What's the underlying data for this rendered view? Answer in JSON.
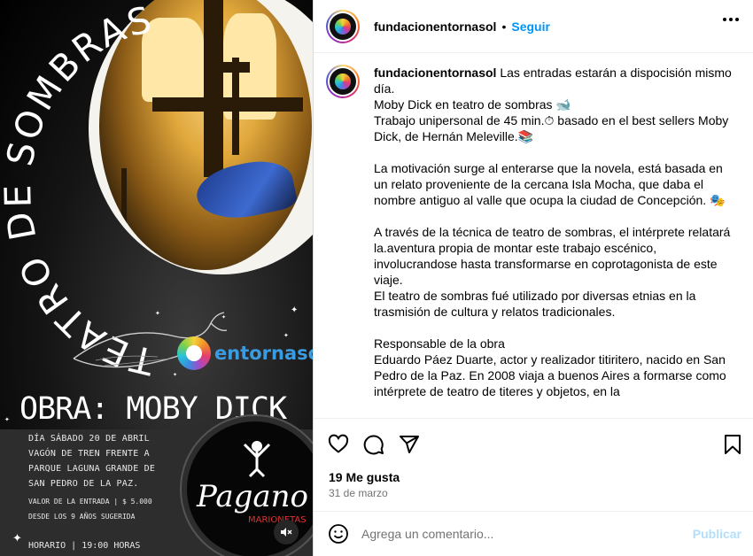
{
  "poster": {
    "title_arc": "TEATRO DE SOMBRAS",
    "brand": "entornasol",
    "obra": "OBRA: MOBY DICK",
    "info_lines": [
      "DÍA SÁBADO 20 DE ABRIL",
      "VAGÓN DE TREN FRENTE A",
      "PARQUE LAGUNA GRANDE DE",
      "SAN PEDRO DE LA PAZ."
    ],
    "price": "VALOR DE LA ENTRADA  |  $ 5.000",
    "age": "DESDE LOS 9 AÑOS SUGERIDA",
    "hours": "HORARIO  |  19:00 HORAS",
    "pagano_logo": "Pagano",
    "pagano_sub": "MARIONETAS"
  },
  "header": {
    "username": "fundacionentornasol",
    "dot": "•",
    "follow_label": "Seguir"
  },
  "caption": {
    "username": "fundacionentornasol",
    "paragraphs": [
      "Las entradas estarán a dispocisión mismo día.\nMoby Dick en teatro de sombras 🐋\nTrabajo unipersonal de 45 min.⏱ basado en el best sellers Moby Dick, de Hernán Meleville.📚",
      "La motivación surge al enterarse que la novela, está basada en un relato proveniente de la cercana Isla Mocha, que daba el nombre antiguo al valle que ocupa la ciudad de Concepción. 🎭",
      "A través de la técnica de teatro de sombras, el intérprete relatará la.aventura propia de montar este trabajo escénico, involucrandose hasta transformarse en coprotagonista de este viaje.\nEl teatro de sombras fué utilizado por diversas etnias en la trasmisión de cultura y relatos tradicionales.",
      "Responsable de la obra\nEduardo Páez Duarte, actor y realizador titiritero, nacido en San Pedro de la Paz. En 2008 viaja a buenos Aires a formarse como intérprete de teatro de titeres y objetos, en la"
    ]
  },
  "post": {
    "likes": "19 Me gusta",
    "date": "31 de marzo"
  },
  "comment": {
    "placeholder": "Agrega un comentario...",
    "publish_label": "Publicar"
  },
  "colors": {
    "accent": "#0095f6",
    "publish_disabled": "#b2dffc",
    "muted": "#737373"
  }
}
